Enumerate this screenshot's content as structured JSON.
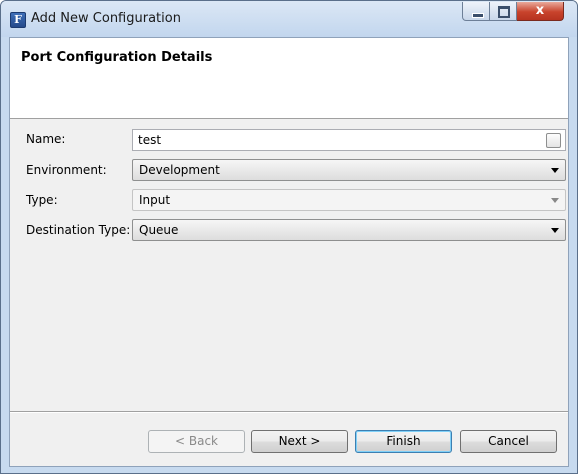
{
  "window": {
    "title": "Add New Configuration",
    "icon_letter": "F",
    "icon": "app-logo-icon"
  },
  "title_controls": {
    "minimize": "minimize-icon",
    "maximize": "maximize-icon",
    "close_glyph": "x"
  },
  "header": {
    "title": "Port Configuration Details"
  },
  "form": {
    "name": {
      "label": "Name:",
      "value": "test",
      "checkbox_checked": false
    },
    "environment": {
      "label": "Environment:",
      "value": "Development"
    },
    "type": {
      "label": "Type:",
      "value": "Input",
      "enabled": false
    },
    "destination_type": {
      "label": "Destination Type:",
      "value": "Queue"
    }
  },
  "buttons": {
    "back": {
      "label": "< Back",
      "enabled": false
    },
    "next": {
      "label": "Next >"
    },
    "finish": {
      "label": "Finish",
      "default": true
    },
    "cancel": {
      "label": "Cancel"
    }
  },
  "colors": {
    "titlebar": "#c2d6ee",
    "close_button": "#c8432c",
    "default_button_border": "#3c7fb1"
  }
}
